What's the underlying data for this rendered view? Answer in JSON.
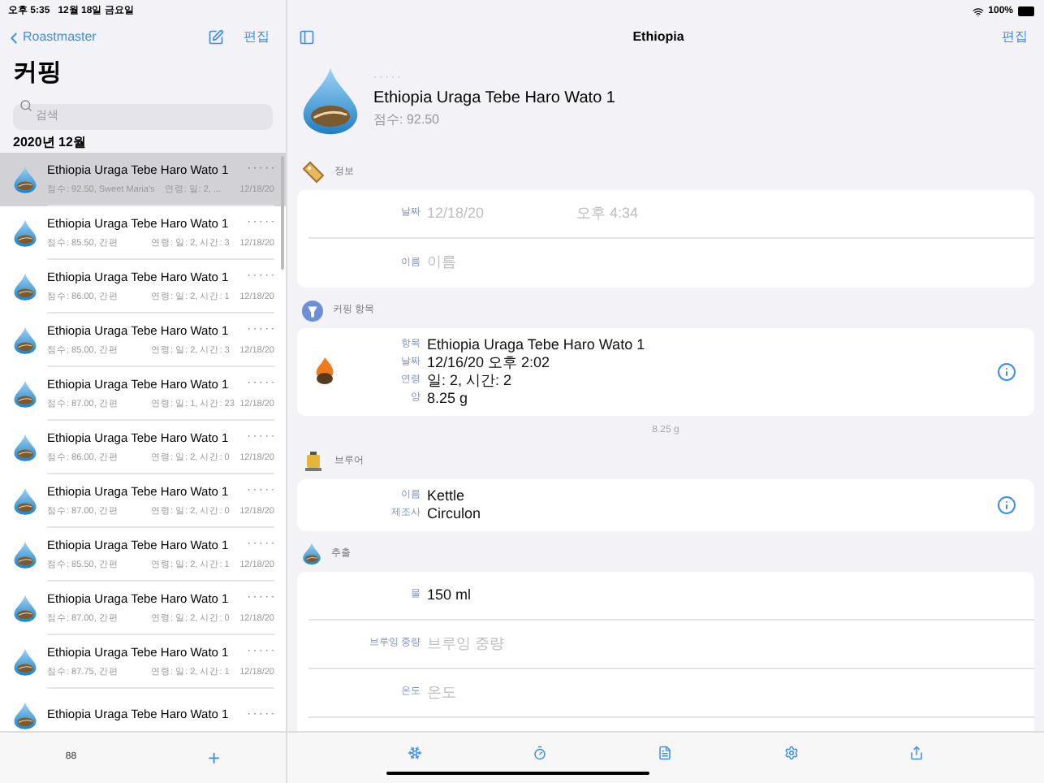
{
  "status_bar": {
    "time": "오후 5:35",
    "date": "12월 18일 금요일",
    "battery": "100%"
  },
  "sidebar": {
    "back": "Roastmaster",
    "edit": "편집",
    "title": "커핑",
    "search": {
      "placeholder": "검색"
    },
    "section": "2020년 12월",
    "items": [
      {
        "title": "Ethiopia Uraga Tebe Haro Wato 1",
        "rating": "· · · · ·",
        "score": "점수: 92.50, Sweet Maria's",
        "age": "연령: 일: 2, ...",
        "date": "12/18/20",
        "selected": true
      },
      {
        "title": "Ethiopia Uraga Tebe Haro Wato 1",
        "rating": "· · · · ·",
        "score": "점수: 85.50, 간편",
        "age": "연령: 일: 2, 시간: 3",
        "date": "12/18/20",
        "selected": false
      },
      {
        "title": "Ethiopia Uraga Tebe Haro Wato 1",
        "rating": "· · · · ·",
        "score": "점수: 86.00, 간편",
        "age": "연령: 일: 2, 시간: 1",
        "date": "12/18/20",
        "selected": false
      },
      {
        "title": "Ethiopia Uraga Tebe Haro Wato 1",
        "rating": "· · · · ·",
        "score": "점수: 85.00, 간편",
        "age": "연령: 일: 2, 시간: 3",
        "date": "12/18/20",
        "selected": false
      },
      {
        "title": "Ethiopia Uraga Tebe Haro Wato 1",
        "rating": "· · · · ·",
        "score": "점수: 87.00, 간편",
        "age": "연령: 일: 1, 시간: 23",
        "date": "12/18/20",
        "selected": false
      },
      {
        "title": "Ethiopia Uraga Tebe Haro Wato 1",
        "rating": "· · · · ·",
        "score": "점수: 86.00, 간편",
        "age": "연령: 일: 2, 시간: 0",
        "date": "12/18/20",
        "selected": false
      },
      {
        "title": "Ethiopia Uraga Tebe Haro Wato 1",
        "rating": "· · · · ·",
        "score": "점수: 87.00, 간편",
        "age": "연령: 일: 2, 시간: 0",
        "date": "12/18/20",
        "selected": false
      },
      {
        "title": "Ethiopia Uraga Tebe Haro Wato 1",
        "rating": "· · · · ·",
        "score": "점수: 85.50, 간편",
        "age": "연령: 일: 2, 시간: 1",
        "date": "12/18/20",
        "selected": false
      },
      {
        "title": "Ethiopia Uraga Tebe Haro Wato 1",
        "rating": "· · · · ·",
        "score": "점수: 87.00, 간편",
        "age": "연령: 일: 2, 시간: 0",
        "date": "12/18/20",
        "selected": false
      },
      {
        "title": "Ethiopia Uraga Tebe Haro Wato 1",
        "rating": "· · · · ·",
        "score": "점수: 87.75, 간편",
        "age": "연령: 일: 2, 시간: 1",
        "date": "12/18/20",
        "selected": false
      },
      {
        "title": "Ethiopia Uraga Tebe Haro Wato 1",
        "rating": "· · · · ·",
        "selected": false
      }
    ],
    "count": "88",
    "add": "+"
  },
  "detail": {
    "nav_title": "Ethiopia",
    "edit": "편집",
    "rating": "· · · · ·",
    "name": "Ethiopia Uraga Tebe Haro Wato 1",
    "score": "점수: 92.50",
    "sections": [
      {
        "kind": "info",
        "title": "정보",
        "rows": [
          {
            "label": "날짜",
            "placeholders": [
              "12/18/20",
              "오후 4:34"
            ]
          },
          {
            "label": "이름",
            "placeholders": [
              "이름"
            ]
          }
        ]
      },
      {
        "kind": "roast",
        "title": "커핑 항목",
        "rows": [
          {
            "label": "항목",
            "value": "Ethiopia Uraga Tebe Haro Wato 1"
          },
          {
            "label": "날짜",
            "value": "12/16/20 오후 2:02"
          },
          {
            "label": "연령",
            "value": "일: 2, 시간: 2"
          },
          {
            "label": "양",
            "value": "8.25 g"
          }
        ],
        "footer": "8.25 g"
      },
      {
        "kind": "brewer",
        "title": "브루어",
        "rows": [
          {
            "label": "이름",
            "value": "Kettle"
          },
          {
            "label": "제조사",
            "value": "Circulon"
          }
        ]
      },
      {
        "kind": "extraction",
        "title": "추출",
        "rows": [
          {
            "label": "물",
            "value": "150 ml"
          },
          {
            "label": "브루잉 중량",
            "placeholders": [
              "브루잉 중량"
            ]
          },
          {
            "label": "온도",
            "placeholders": [
              "온도"
            ]
          }
        ]
      }
    ]
  }
}
